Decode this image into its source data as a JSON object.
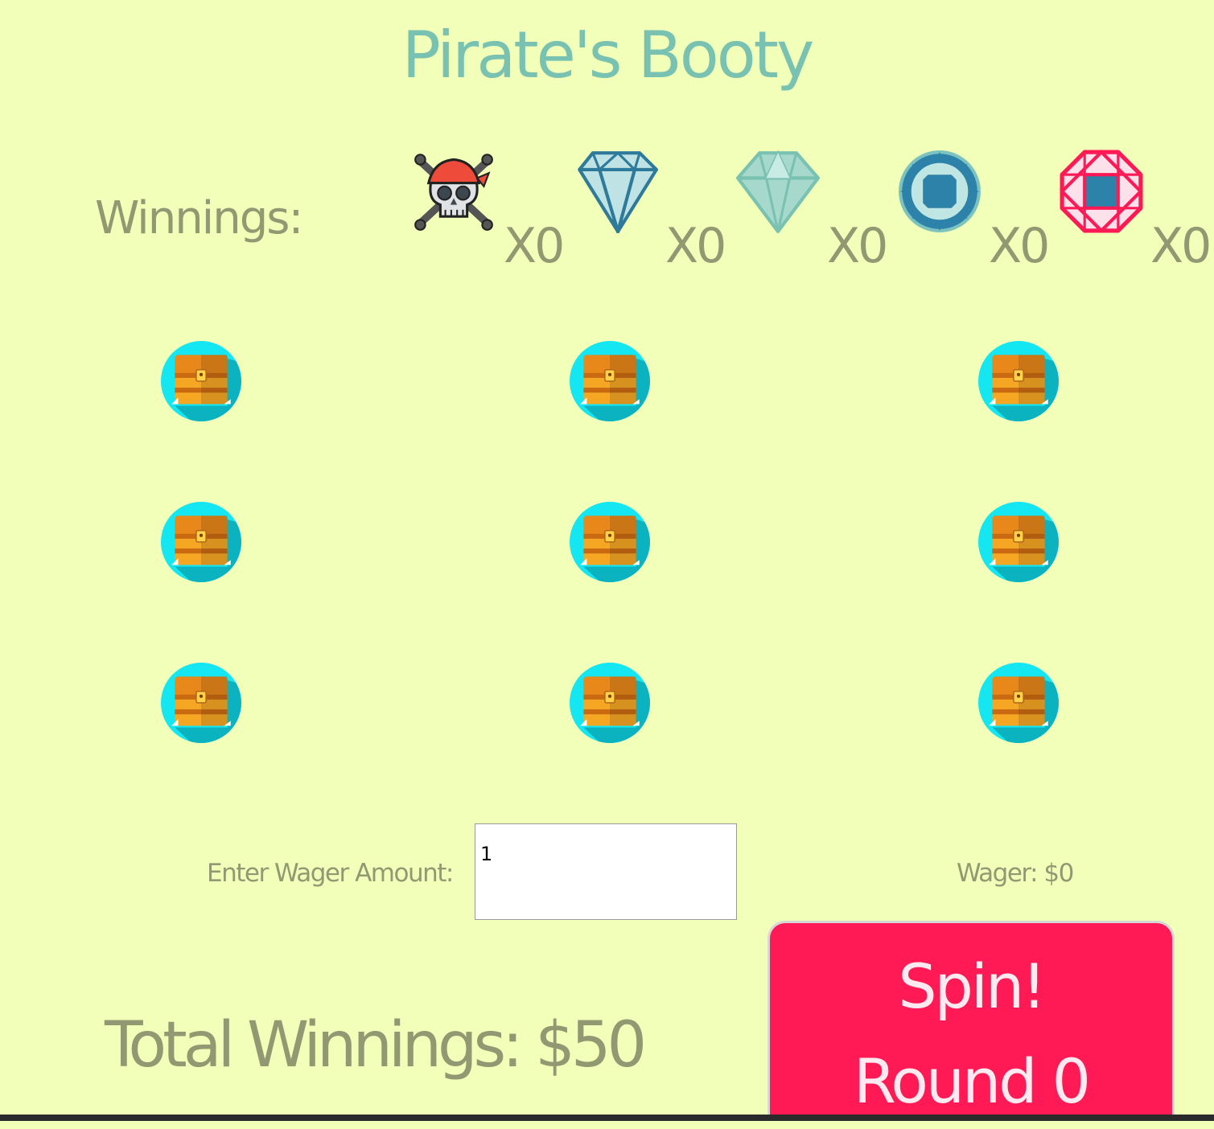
{
  "title": "Pirate's Booty",
  "winnings": {
    "label": "Winnings:",
    "symbols": [
      {
        "icon": "pirate-skull-icon",
        "multiplier": "X0"
      },
      {
        "icon": "blue-diamond-icon",
        "multiplier": "X0"
      },
      {
        "icon": "teal-diamond-icon",
        "multiplier": "X0"
      },
      {
        "icon": "blue-round-gem-icon",
        "multiplier": "X0"
      },
      {
        "icon": "red-octagon-gem-icon",
        "multiplier": "X0"
      }
    ]
  },
  "reels": {
    "rows": 3,
    "columns": 3,
    "cell_icon": "treasure-chest-icon"
  },
  "wager": {
    "label": "Enter Wager Amount:",
    "input_value": "1",
    "display": "Wager: $0"
  },
  "total": "Total Winnings: $50",
  "spin": {
    "line1": "Spin!",
    "line2": "Round 0"
  },
  "colors": {
    "background": "#f2ffb9",
    "title": "#79c2b2",
    "text": "#919872",
    "spin_button": "#ff1a55",
    "reel_circle": "#14e6f2"
  }
}
